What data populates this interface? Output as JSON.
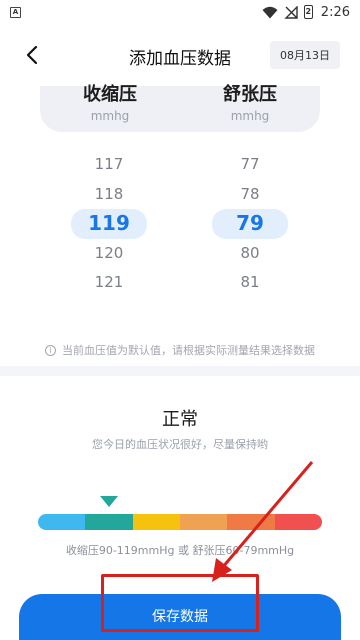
{
  "status_bar": {
    "notification_letter": "A",
    "battery_level": "2",
    "time": "2:26"
  },
  "header": {
    "title": "添加血压数据",
    "date": "08月13日",
    "back_icon": "chevron-left-icon"
  },
  "columns": {
    "systolic": {
      "label": "收缩压",
      "unit": "mmhg"
    },
    "diastolic": {
      "label": "舒张压",
      "unit": "mmhg"
    }
  },
  "pickers": {
    "systolic": {
      "values": [
        "117",
        "118",
        "119",
        "120",
        "121"
      ],
      "selected_index": 2
    },
    "diastolic": {
      "values": [
        "77",
        "78",
        "79",
        "80",
        "81"
      ],
      "selected_index": 2
    }
  },
  "notice": "当前血压值为默认值，请根据实际测量结果选择数据",
  "result": {
    "status": "正常",
    "description": "您今日的血压状况很好，尽量保持哟",
    "range_text": "收缩压90-119mmHg 或 舒张压60-79mmHg",
    "scale_colors": [
      "#3fb8f0",
      "#22a79a",
      "#f5c20e",
      "#efa252",
      "#f07a45",
      "#f0504f"
    ],
    "marker_segment_index": 1
  },
  "save_button": {
    "label": "保存数据",
    "color": "#1576e8"
  },
  "annotation_color": "#d8211c"
}
